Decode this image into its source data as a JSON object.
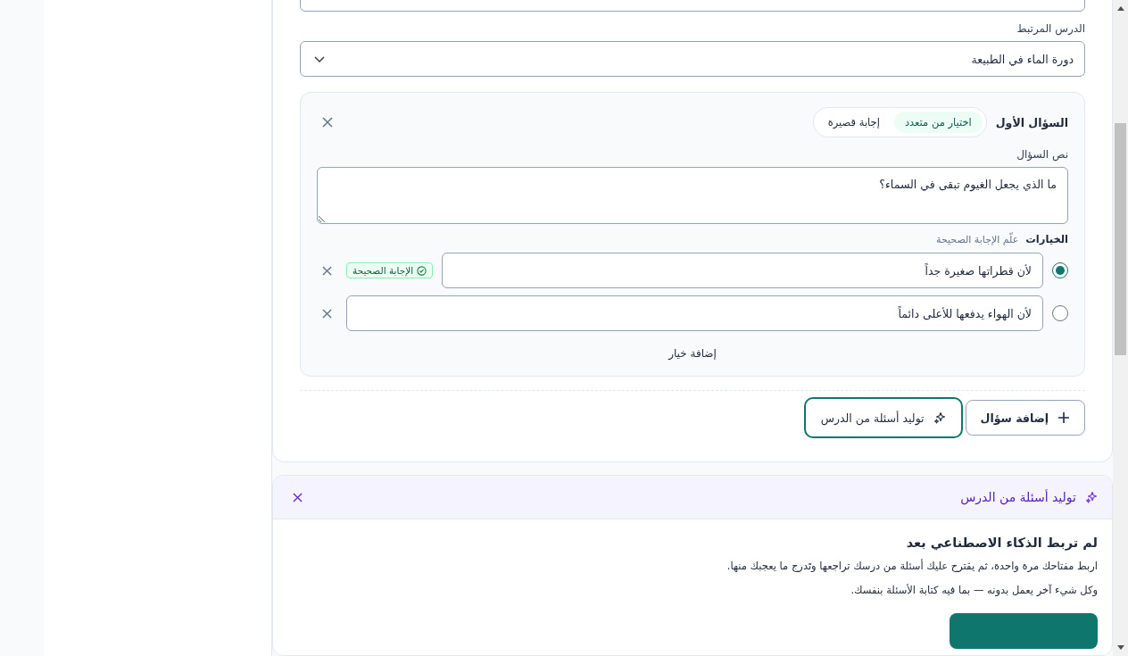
{
  "lesson_field": {
    "label": "الدرس المرتبط",
    "value": "دورة الماء في الطبيعة"
  },
  "question": {
    "title": "السؤال الأول",
    "types": [
      {
        "label": "اختيار من متعدد",
        "selected": true
      },
      {
        "label": "إجابة قصيرة",
        "selected": false
      }
    ],
    "text_label": "نص السؤال",
    "text": "ما الذي يجعل الغيوم تبقى في السماء؟",
    "options_label": "الخيارات",
    "options_hint": "علّم الإجابة الصحيحة",
    "options": [
      {
        "text": "لأن قطراتها صغيرة جداً",
        "selected": true,
        "badge": "الإجابة الصحيحة"
      },
      {
        "text": "لأن الهواء يدفعها للأعلى دائماً",
        "selected": false
      }
    ],
    "add_option": "إضافة خيار"
  },
  "actions": [
    {
      "label": "إضافة سؤال",
      "kind": "add"
    },
    {
      "label": "توليد أسئلة من الدرس",
      "kind": "generate"
    }
  ],
  "ai_panel": {
    "title": "توليد أسئلة من الدرس",
    "heading": "لم تربط الذكاء الاصطناعي بعد",
    "paragraphs": [
      "اربط مفتاحك مرة واحدة، ثم يقترح عليك أسئلة من درسك تراجعها وتَدرج ما يعجبك منها.",
      "وكل شيء آخر يعمل بدونه — بما فيه كتابة الأسئلة بنفسك."
    ]
  }
}
